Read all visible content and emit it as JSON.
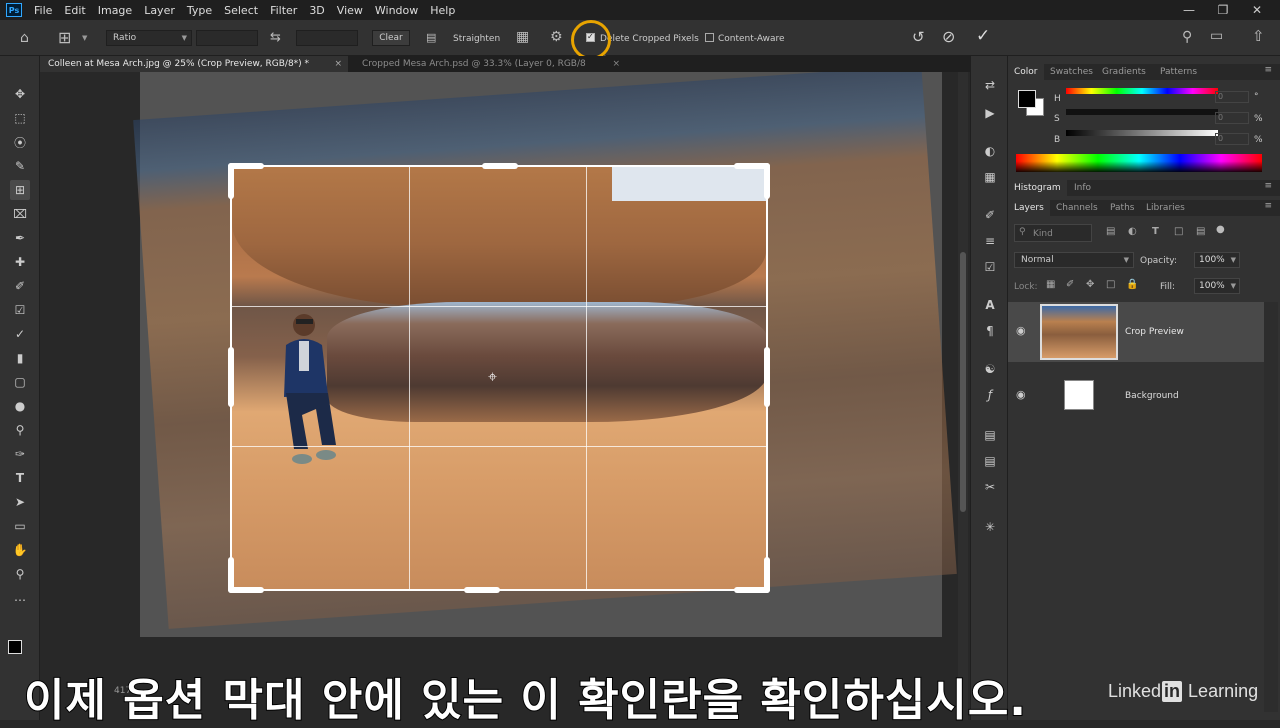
{
  "app": {
    "logo": "Ps"
  },
  "menu": [
    "File",
    "Edit",
    "Image",
    "Layer",
    "Type",
    "Select",
    "Filter",
    "3D",
    "View",
    "Window",
    "Help"
  ],
  "options_bar": {
    "ratio_select": "Ratio",
    "clear_label": "Clear",
    "straighten_label": "Straighten",
    "delete_cropped_label": "Delete Cropped Pixels",
    "delete_cropped_checked": true,
    "content_aware_label": "Content-Aware",
    "content_aware_checked": false
  },
  "tabs": [
    {
      "label": "Colleen at Mesa Arch.jpg @ 25% (Crop Preview, RGB/8*) *",
      "active": true
    },
    {
      "label": "Cropped Mesa Arch.psd @ 33.3% (Layer 0, RGB/8",
      "active": false
    }
  ],
  "color_panel": {
    "tabs": [
      "Color",
      "Swatches",
      "Gradients",
      "Patterns"
    ],
    "channels": [
      "H",
      "S",
      "B"
    ],
    "units": [
      "°",
      "%",
      "%"
    ],
    "values": [
      "0",
      "0",
      "0"
    ]
  },
  "histogram_tabs": [
    "Histogram",
    "Info"
  ],
  "layers_panel": {
    "tabs": [
      "Layers",
      "Channels",
      "Paths",
      "Libraries"
    ],
    "kind_placeholder": "Kind",
    "blend_mode": "Normal",
    "opacity_label": "Opacity:",
    "opacity_value": "100%",
    "lock_label": "Lock:",
    "fill_label": "Fill:",
    "fill_value": "100%",
    "layers": [
      {
        "name": "Crop Preview",
        "selected": true
      },
      {
        "name": "Background",
        "selected": false
      }
    ]
  },
  "status": {
    "zoom": "417"
  },
  "caption": "이제 옵션 막대 안에 있는 이 확인란을 확인하십시오.",
  "watermark": {
    "pre": "Linked",
    "box": "in",
    "post": " Learning"
  },
  "colors": {
    "accent": "#e8a400",
    "panel_bg": "#323232",
    "dark_bg": "#1f1f1f"
  }
}
